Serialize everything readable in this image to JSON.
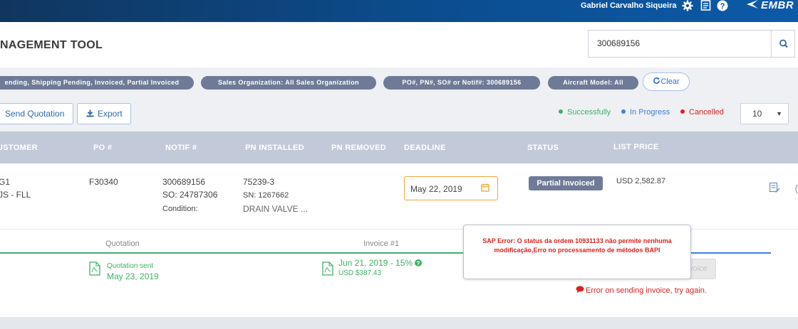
{
  "topbar": {
    "user_name": "Gabriel Carvalho Siqueira",
    "brand": "EMBR",
    "icons": [
      "gear-icon",
      "document-icon",
      "help-icon",
      "brand-logo-icon"
    ]
  },
  "header": {
    "title": "NAGEMENT TOOL",
    "search_value": "300689156"
  },
  "filters": {
    "chips": [
      "ending, Shipping Pending, Invoiced, Partial Invoiced",
      "Sales Organization: All Sales Organization",
      "PO#, PN#, SO# or Notif#: 300689156",
      "Aircraft Model: All"
    ],
    "clear_label": "Clear"
  },
  "actions": {
    "send_quotation_label": "Send Quotation",
    "export_label": "Export",
    "page_size": "10"
  },
  "legend": [
    {
      "label": "Successfully",
      "color": "#3fb068"
    },
    {
      "label": "In Progress",
      "color": "#3d7fe0"
    },
    {
      "label": "Cancelled",
      "color": "#d9231d"
    }
  ],
  "table": {
    "headers": [
      "USTOMER",
      "PO #",
      "NOTIF #",
      "PN INSTALLED",
      "PN REMOVED",
      "DEADLINE",
      "STATUS",
      "LIST PRICE"
    ],
    "row": {
      "customer_line1": "G1",
      "customer_line2": "JS - FLL",
      "po": "F30340",
      "notif": "300689156",
      "so": "SO: 24787306",
      "condition": "Condition:",
      "pn_installed": "75239-3",
      "sn": "SN: 1267662",
      "description": "DRAIN VALVE ...",
      "deadline": "May 22, 2019",
      "status": "Partial Invoiced",
      "list_price": "USD 2,582.87"
    }
  },
  "expand": {
    "steps": [
      "Quotation",
      "Invoice #1"
    ],
    "quotation": {
      "title": "Quotation sent",
      "date": "May 23, 2019"
    },
    "invoice": {
      "title": "Jun 21, 2019 - 15%",
      "amount": "USD $387.43"
    },
    "ghost_button": "voice",
    "error": "Error on sending invoice, try again."
  },
  "tooltip": {
    "text": "SAP Error: O status da ordem 10931133 não permite nenhuma modificação,Erro no processamento de métodos BAPI"
  },
  "colors": {
    "topbar": "#0b4d8f",
    "chip": "#6e7a96",
    "success": "#3fb068",
    "error": "#d9231d",
    "accent": "#2d6fd0"
  }
}
